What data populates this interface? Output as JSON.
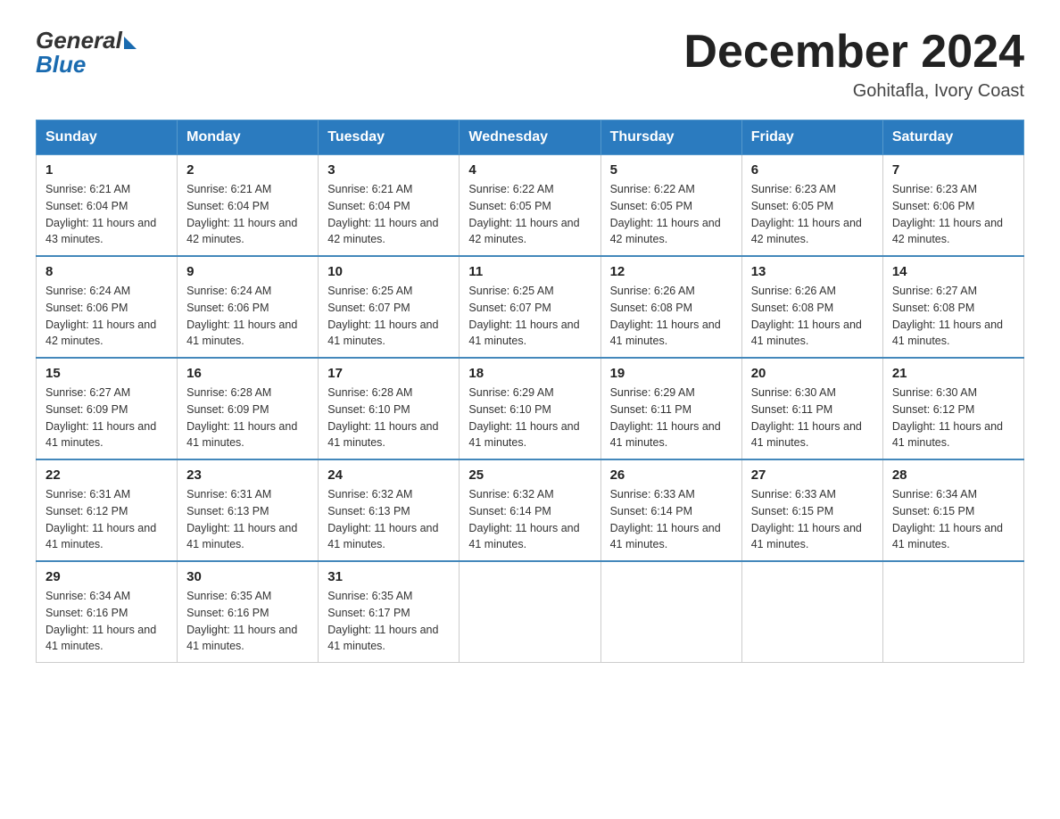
{
  "logo": {
    "general": "General",
    "blue": "Blue"
  },
  "title": "December 2024",
  "location": "Gohitafla, Ivory Coast",
  "weekdays": [
    "Sunday",
    "Monday",
    "Tuesday",
    "Wednesday",
    "Thursday",
    "Friday",
    "Saturday"
  ],
  "weeks": [
    [
      {
        "day": "1",
        "sunrise": "6:21 AM",
        "sunset": "6:04 PM",
        "daylight": "11 hours and 43 minutes."
      },
      {
        "day": "2",
        "sunrise": "6:21 AM",
        "sunset": "6:04 PM",
        "daylight": "11 hours and 42 minutes."
      },
      {
        "day": "3",
        "sunrise": "6:21 AM",
        "sunset": "6:04 PM",
        "daylight": "11 hours and 42 minutes."
      },
      {
        "day": "4",
        "sunrise": "6:22 AM",
        "sunset": "6:05 PM",
        "daylight": "11 hours and 42 minutes."
      },
      {
        "day": "5",
        "sunrise": "6:22 AM",
        "sunset": "6:05 PM",
        "daylight": "11 hours and 42 minutes."
      },
      {
        "day": "6",
        "sunrise": "6:23 AM",
        "sunset": "6:05 PM",
        "daylight": "11 hours and 42 minutes."
      },
      {
        "day": "7",
        "sunrise": "6:23 AM",
        "sunset": "6:06 PM",
        "daylight": "11 hours and 42 minutes."
      }
    ],
    [
      {
        "day": "8",
        "sunrise": "6:24 AM",
        "sunset": "6:06 PM",
        "daylight": "11 hours and 42 minutes."
      },
      {
        "day": "9",
        "sunrise": "6:24 AM",
        "sunset": "6:06 PM",
        "daylight": "11 hours and 41 minutes."
      },
      {
        "day": "10",
        "sunrise": "6:25 AM",
        "sunset": "6:07 PM",
        "daylight": "11 hours and 41 minutes."
      },
      {
        "day": "11",
        "sunrise": "6:25 AM",
        "sunset": "6:07 PM",
        "daylight": "11 hours and 41 minutes."
      },
      {
        "day": "12",
        "sunrise": "6:26 AM",
        "sunset": "6:08 PM",
        "daylight": "11 hours and 41 minutes."
      },
      {
        "day": "13",
        "sunrise": "6:26 AM",
        "sunset": "6:08 PM",
        "daylight": "11 hours and 41 minutes."
      },
      {
        "day": "14",
        "sunrise": "6:27 AM",
        "sunset": "6:08 PM",
        "daylight": "11 hours and 41 minutes."
      }
    ],
    [
      {
        "day": "15",
        "sunrise": "6:27 AM",
        "sunset": "6:09 PM",
        "daylight": "11 hours and 41 minutes."
      },
      {
        "day": "16",
        "sunrise": "6:28 AM",
        "sunset": "6:09 PM",
        "daylight": "11 hours and 41 minutes."
      },
      {
        "day": "17",
        "sunrise": "6:28 AM",
        "sunset": "6:10 PM",
        "daylight": "11 hours and 41 minutes."
      },
      {
        "day": "18",
        "sunrise": "6:29 AM",
        "sunset": "6:10 PM",
        "daylight": "11 hours and 41 minutes."
      },
      {
        "day": "19",
        "sunrise": "6:29 AM",
        "sunset": "6:11 PM",
        "daylight": "11 hours and 41 minutes."
      },
      {
        "day": "20",
        "sunrise": "6:30 AM",
        "sunset": "6:11 PM",
        "daylight": "11 hours and 41 minutes."
      },
      {
        "day": "21",
        "sunrise": "6:30 AM",
        "sunset": "6:12 PM",
        "daylight": "11 hours and 41 minutes."
      }
    ],
    [
      {
        "day": "22",
        "sunrise": "6:31 AM",
        "sunset": "6:12 PM",
        "daylight": "11 hours and 41 minutes."
      },
      {
        "day": "23",
        "sunrise": "6:31 AM",
        "sunset": "6:13 PM",
        "daylight": "11 hours and 41 minutes."
      },
      {
        "day": "24",
        "sunrise": "6:32 AM",
        "sunset": "6:13 PM",
        "daylight": "11 hours and 41 minutes."
      },
      {
        "day": "25",
        "sunrise": "6:32 AM",
        "sunset": "6:14 PM",
        "daylight": "11 hours and 41 minutes."
      },
      {
        "day": "26",
        "sunrise": "6:33 AM",
        "sunset": "6:14 PM",
        "daylight": "11 hours and 41 minutes."
      },
      {
        "day": "27",
        "sunrise": "6:33 AM",
        "sunset": "6:15 PM",
        "daylight": "11 hours and 41 minutes."
      },
      {
        "day": "28",
        "sunrise": "6:34 AM",
        "sunset": "6:15 PM",
        "daylight": "11 hours and 41 minutes."
      }
    ],
    [
      {
        "day": "29",
        "sunrise": "6:34 AM",
        "sunset": "6:16 PM",
        "daylight": "11 hours and 41 minutes."
      },
      {
        "day": "30",
        "sunrise": "6:35 AM",
        "sunset": "6:16 PM",
        "daylight": "11 hours and 41 minutes."
      },
      {
        "day": "31",
        "sunrise": "6:35 AM",
        "sunset": "6:17 PM",
        "daylight": "11 hours and 41 minutes."
      },
      null,
      null,
      null,
      null
    ]
  ]
}
